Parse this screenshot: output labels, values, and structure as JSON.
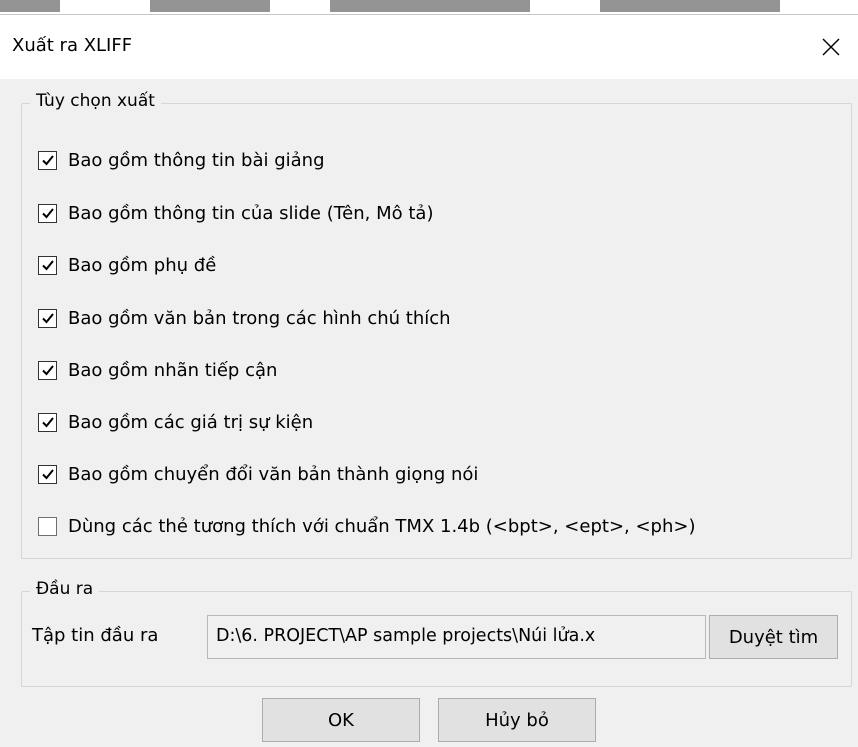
{
  "dialog": {
    "title": "Xuất ra XLIFF",
    "close_icon": "close-icon"
  },
  "options_group": {
    "legend": "Tùy chọn xuất",
    "items": [
      {
        "label": "Bao gồm thông tin bài giảng",
        "checked": true
      },
      {
        "label": "Bao gồm thông tin của slide (Tên, Mô tả)",
        "checked": true
      },
      {
        "label": "Bao gồm phụ đề",
        "checked": true
      },
      {
        "label": "Bao gồm văn bản trong các hình chú thích",
        "checked": true
      },
      {
        "label": "Bao gồm nhãn tiếp cận",
        "checked": true
      },
      {
        "label": "Bao gồm các giá trị sự kiện",
        "checked": true
      },
      {
        "label": "Bao gồm chuyển đổi văn bản thành giọng nói",
        "checked": true
      },
      {
        "label": "Dùng các thẻ tương thích với chuẩn TMX 1.4b (<bpt>, <ept>, <ph>)",
        "checked": false
      }
    ]
  },
  "output_group": {
    "legend": "Đầu ra",
    "file_label": "Tập tin đầu ra",
    "file_path": "D:\\6. PROJECT\\AP sample projects\\Núi lửa.x",
    "browse_label": "Duyệt tìm"
  },
  "buttons": {
    "ok_label": "OK",
    "cancel_label": "Hủy bỏ"
  },
  "colors": {
    "dialog_bg": "#f0f0f0",
    "titlebar_bg": "#ffffff",
    "button_bg": "#e1e1e1"
  }
}
